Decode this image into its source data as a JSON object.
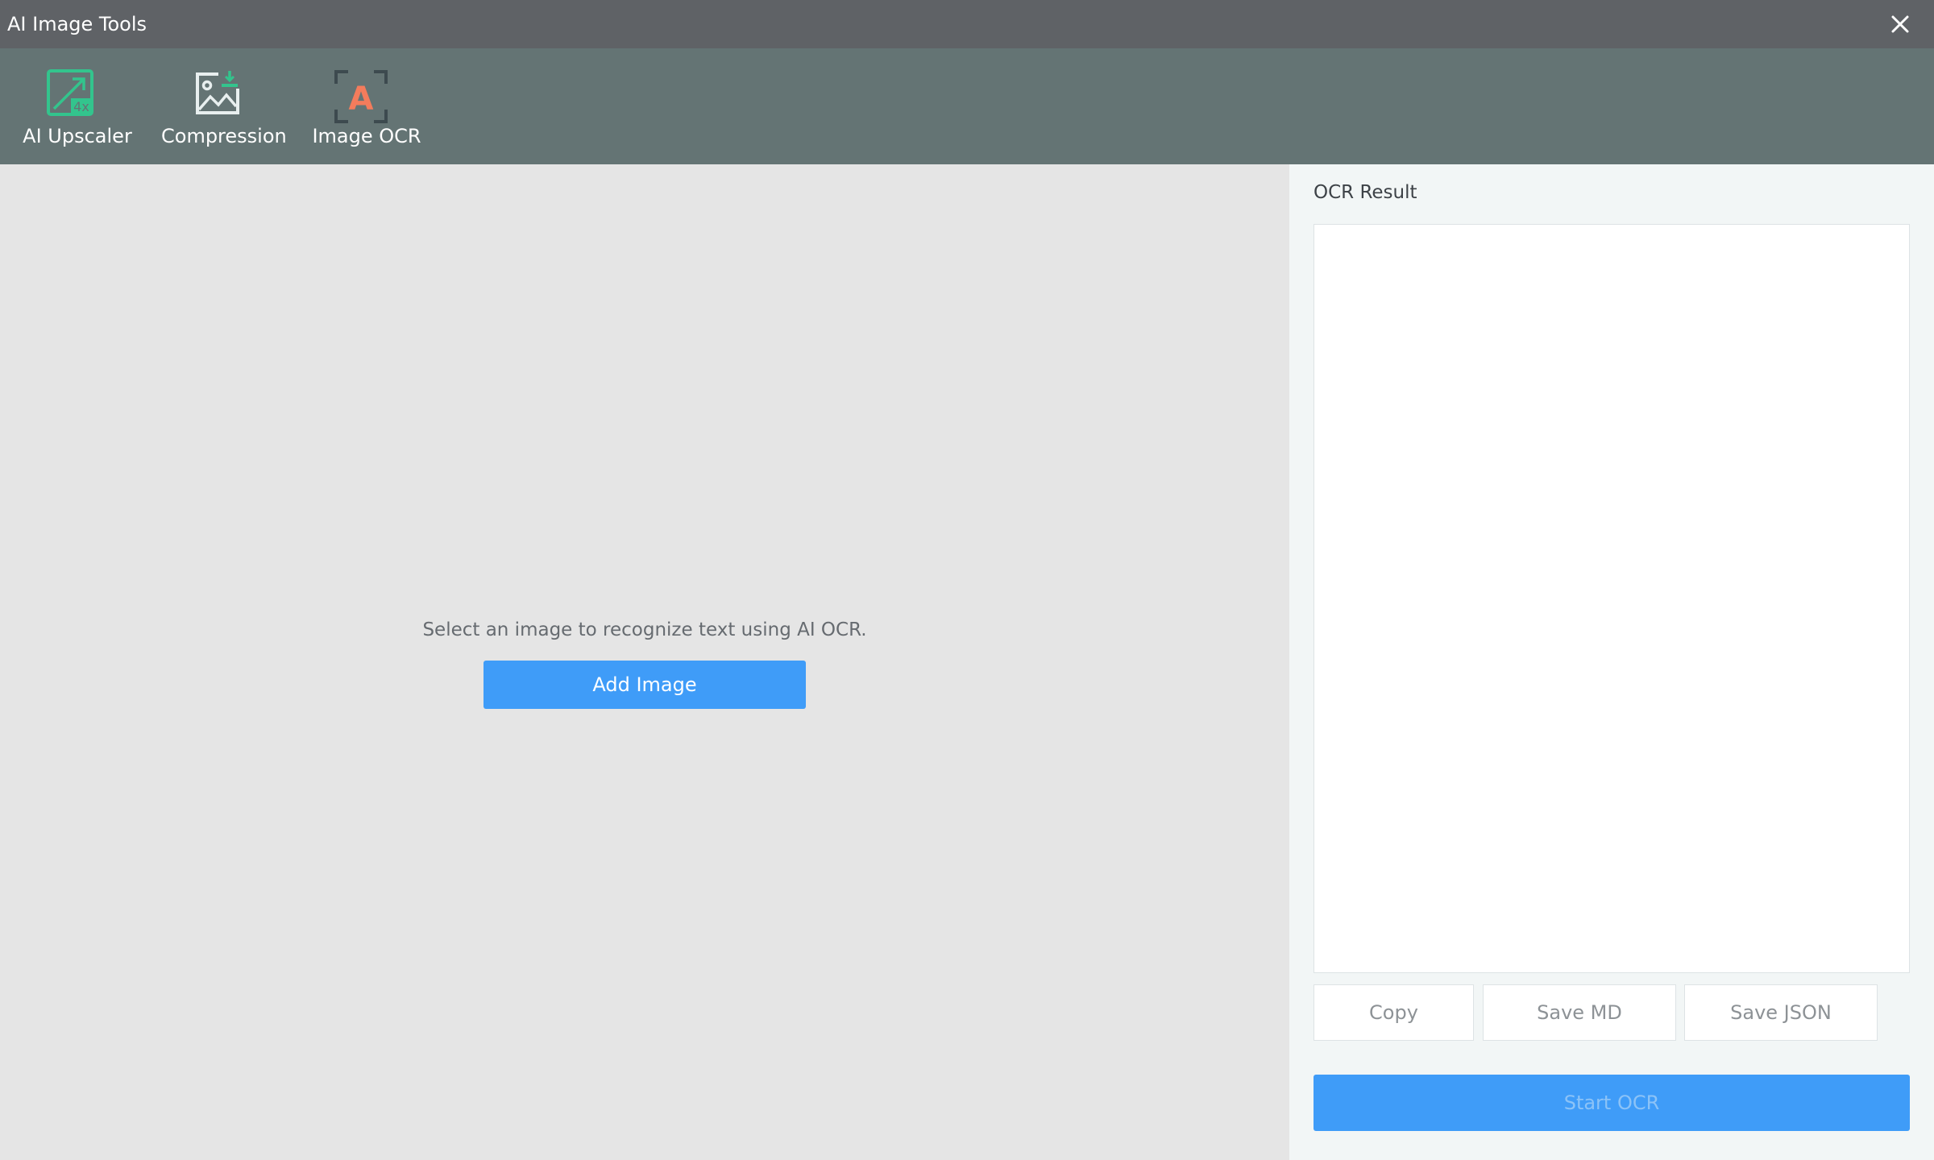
{
  "window": {
    "title": "AI Image Tools",
    "close_icon": "close-icon"
  },
  "toolbar": {
    "tools": [
      {
        "label": "AI Upscaler",
        "icon": "upscale-4x-icon",
        "icon_text": "4x"
      },
      {
        "label": "Compression",
        "icon": "image-compress-icon"
      },
      {
        "label": "Image OCR",
        "icon": "text-scan-icon",
        "icon_text": "A"
      }
    ]
  },
  "canvas": {
    "hint": "Select an image to recognize text using AI OCR.",
    "add_button": "Add Image"
  },
  "panel": {
    "heading": "OCR Result",
    "result_value": "",
    "buttons": {
      "copy": "Copy",
      "save_md": "Save MD",
      "save_json": "Save JSON"
    },
    "start_button": "Start OCR"
  },
  "colors": {
    "titlebar": "#5f6266",
    "toolbar": "#647474",
    "accent_blue": "#3f9cf8",
    "accent_green": "#33c48d",
    "ocr_orange": "#f37c5c"
  }
}
